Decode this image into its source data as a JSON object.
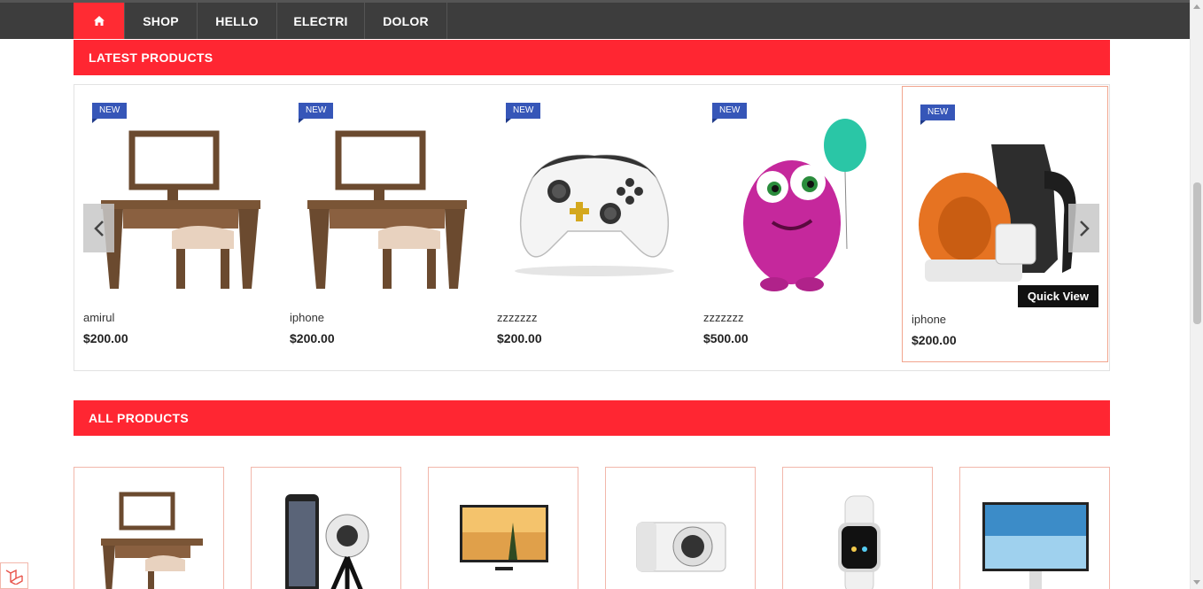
{
  "colors": {
    "accent": "#ff2632",
    "nav_bg": "#3d3d3d",
    "badge": "#3656b8",
    "card_border": "#f2a58e"
  },
  "nav": {
    "home_icon": "home-icon",
    "items": [
      {
        "label": "SHOP"
      },
      {
        "label": "HELLO"
      },
      {
        "label": "ELECTRI"
      },
      {
        "label": "DOLOR"
      }
    ]
  },
  "latest": {
    "title": "LATEST PRODUCTS",
    "badge": "NEW",
    "quick_view": "Quick View",
    "products": [
      {
        "name": "amirul",
        "price": "$200.00",
        "image": "dressing-table"
      },
      {
        "name": "iphone",
        "price": "$200.00",
        "image": "dressing-table"
      },
      {
        "name": "zzzzzzz",
        "price": "$200.00",
        "image": "game-controller"
      },
      {
        "name": "zzzzzzz",
        "price": "$500.00",
        "image": "pink-monster-toy"
      },
      {
        "name": "iphone",
        "price": "$200.00",
        "image": "leaf-blower"
      }
    ]
  },
  "all": {
    "title": "ALL PRODUCTS",
    "products": [
      {
        "image": "dressing-table"
      },
      {
        "image": "phone-360-camera"
      },
      {
        "image": "tv"
      },
      {
        "image": "camera"
      },
      {
        "image": "smartwatch"
      },
      {
        "image": "monitor"
      }
    ]
  }
}
